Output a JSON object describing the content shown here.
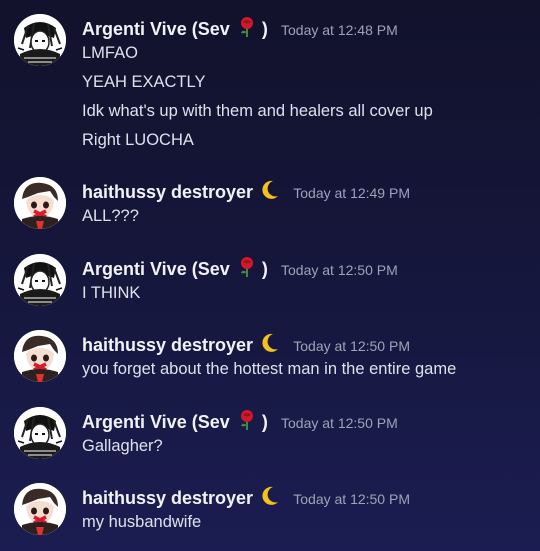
{
  "messages": [
    {
      "username": "Argenti Vive (Sev",
      "emoji": "rose-emoji",
      "closing": ")",
      "timestamp": "Today at 12:48 PM",
      "lines": [
        "LMFAO",
        "YEAH EXACTLY",
        "Idk what's up with them and healers all cover up",
        "Right LUOCHA"
      ]
    },
    {
      "username": "haithussy destroyer",
      "emoji": "crescent-moon-emoji",
      "timestamp": "Today at 12:49 PM",
      "lines": [
        "ALL???"
      ]
    },
    {
      "username": "Argenti Vive (Sev",
      "emoji": "rose-emoji",
      "closing": ")",
      "timestamp": "Today at 12:50 PM",
      "lines": [
        "I THINK"
      ]
    },
    {
      "username": "haithussy destroyer",
      "emoji": "crescent-moon-emoji",
      "timestamp": "Today at 12:50 PM",
      "lines": [
        "you forget about the hottest man in the entire game"
      ]
    },
    {
      "username": "Argenti Vive (Sev",
      "emoji": "rose-emoji",
      "closing": ")",
      "timestamp": "Today at 12:50 PM",
      "lines": [
        "Gallagher?"
      ]
    },
    {
      "username": "haithussy destroyer",
      "emoji": "crescent-moon-emoji",
      "timestamp": "Today at 12:50 PM",
      "lines": [
        "my husbandwife"
      ]
    }
  ],
  "colors": {
    "background_top": "#12122c",
    "background_bottom": "#1b1d52",
    "username": "#f1f2f6",
    "timestamp": "#9fa3b5",
    "message_text": "#dfe1ea"
  }
}
